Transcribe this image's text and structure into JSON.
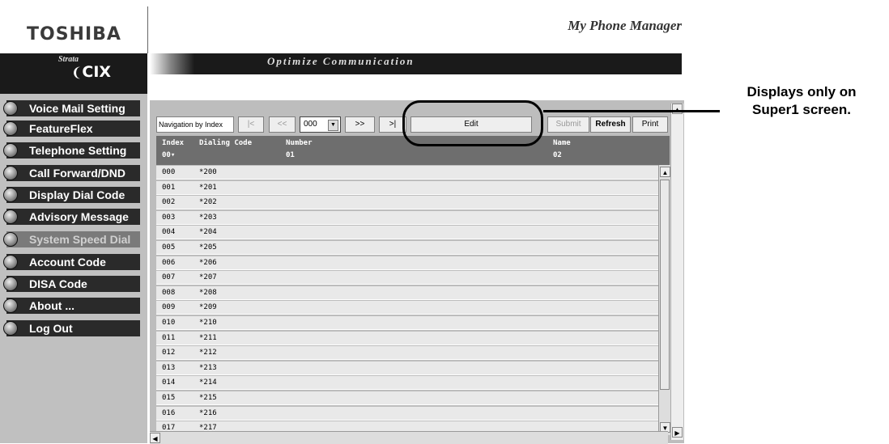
{
  "brand": {
    "company": "TOSHIBA",
    "product_line": "Strata",
    "product": "CIX"
  },
  "header": {
    "title": "My Phone Manager",
    "tagline": "Optimize Communication"
  },
  "sidebar": {
    "items": [
      {
        "label": "Voice Mail Setting",
        "enabled": true
      },
      {
        "label": "FeatureFlex",
        "enabled": true
      },
      {
        "label": "Telephone Setting",
        "enabled": true
      },
      {
        "label": "Call Forward/DND",
        "enabled": true
      },
      {
        "label": "Display Dial Code",
        "enabled": true
      },
      {
        "label": "Advisory Message",
        "enabled": true
      },
      {
        "label": "System Speed Dial",
        "enabled": false
      },
      {
        "label": "Account Code",
        "enabled": true
      },
      {
        "label": "DISA Code",
        "enabled": true
      },
      {
        "label": "About ...",
        "enabled": true
      },
      {
        "label": "Log Out",
        "enabled": true
      }
    ]
  },
  "toolbar": {
    "nav_label": "Navigation by Index",
    "first": "|<",
    "prev": "<<",
    "index_value": "000",
    "next": ">>",
    "last": ">|",
    "edit": "Edit",
    "submit": "Submit",
    "refresh": "Refresh",
    "print": "Print"
  },
  "table": {
    "headers": {
      "index": "Index",
      "index_sub": "00▾",
      "dialing_code": "Dialing Code",
      "number": "Number",
      "number_sub": "01",
      "name": "Name",
      "name_sub": "02"
    },
    "rows": [
      [
        "000",
        "*200"
      ],
      [
        "001",
        "*201"
      ],
      [
        "002",
        "*202"
      ],
      [
        "003",
        "*203"
      ],
      [
        "004",
        "*204"
      ],
      [
        "005",
        "*205"
      ],
      [
        "006",
        "*206"
      ],
      [
        "007",
        "*207"
      ],
      [
        "008",
        "*208"
      ],
      [
        "009",
        "*209"
      ],
      [
        "010",
        "*210"
      ],
      [
        "011",
        "*211"
      ],
      [
        "012",
        "*212"
      ],
      [
        "013",
        "*213"
      ],
      [
        "014",
        "*214"
      ],
      [
        "015",
        "*215"
      ],
      [
        "016",
        "*216"
      ],
      [
        "017",
        "*217"
      ]
    ]
  },
  "callout": {
    "line1": "Displays only on",
    "line2": "Super1 screen."
  }
}
